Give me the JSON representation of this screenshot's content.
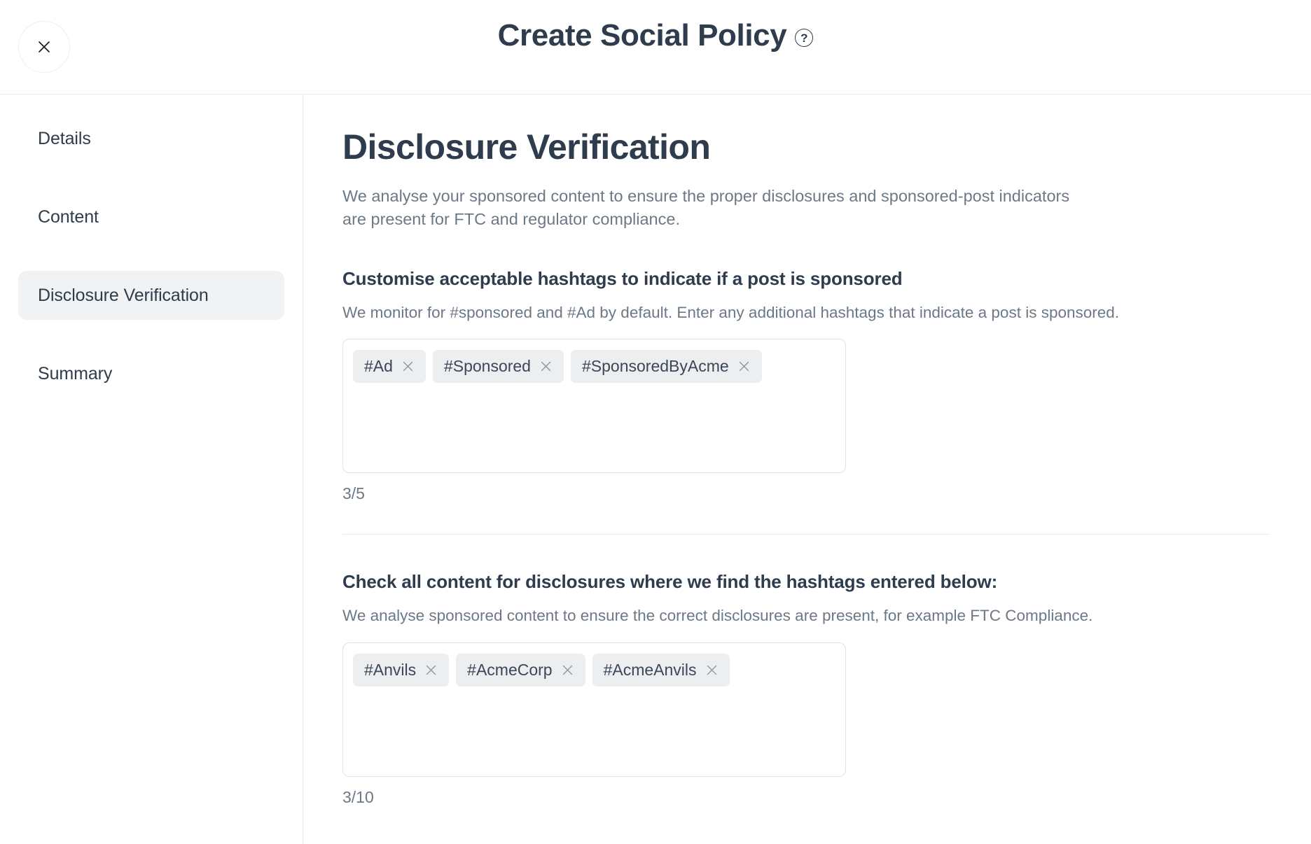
{
  "header": {
    "title": "Create Social Policy",
    "help_icon": "question-circle-icon",
    "help_glyph": "?",
    "close_icon": "close-icon"
  },
  "sidebar": {
    "items": [
      {
        "label": "Details",
        "active": false
      },
      {
        "label": "Content",
        "active": false
      },
      {
        "label": "Disclosure Verification",
        "active": true
      },
      {
        "label": "Summary",
        "active": false
      }
    ]
  },
  "main": {
    "page_title": "Disclosure Verification",
    "page_description": "We analyse your sponsored content to ensure the proper disclosures and sponsored-post indicators are present for FTC and regulator compliance.",
    "sections": [
      {
        "title": "Customise acceptable hashtags to indicate if a post is sponsored",
        "description": "We monitor for #sponsored and #Ad by default. Enter any additional hashtags that indicate a post is sponsored.",
        "tags": [
          "#Ad",
          "#Sponsored",
          "#SponsoredByAcme"
        ],
        "counter": "3/5",
        "input_placeholder": ""
      },
      {
        "title": "Check all content for disclosures where we find the hashtags entered below:",
        "description": "We analyse sponsored content to ensure the correct disclosures are present, for example FTC Compliance.",
        "tags": [
          "#Anvils",
          "#AcmeCorp",
          "#AcmeAnvils"
        ],
        "counter": "3/10",
        "input_placeholder": ""
      }
    ]
  },
  "colors": {
    "text_dark": "#2e3c4d",
    "text_muted": "#6d7886",
    "chip_bg": "#eceef0",
    "active_nav_bg": "#f0f2f4",
    "border": "#e7e9ec"
  }
}
